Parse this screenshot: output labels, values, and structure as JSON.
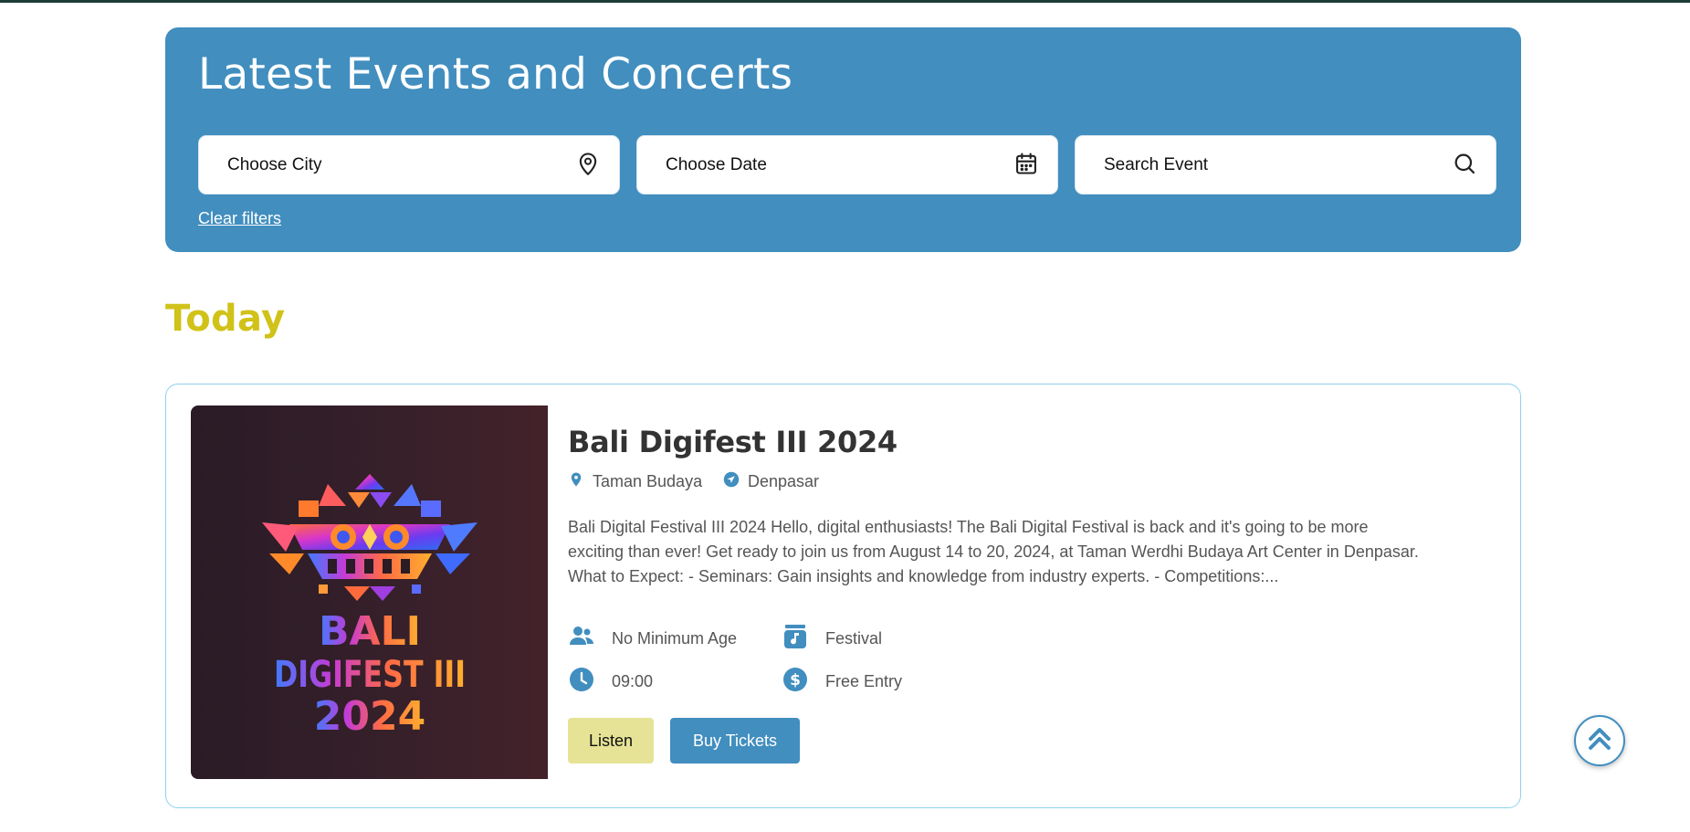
{
  "hero": {
    "title": "Latest Events and Concerts",
    "city_placeholder": "Choose City",
    "date_placeholder": "Choose Date",
    "search_placeholder": "Search Event",
    "clear_filters": "Clear filters"
  },
  "section": {
    "title": "Today"
  },
  "event": {
    "title": "Bali Digifest III 2024",
    "venue": "Taman Budaya",
    "city": "Denpasar",
    "description": "Bali Digital Festival III 2024 Hello, digital enthusiasts! The Bali Digital Festival is back and it's going to be more exciting than ever! Get ready to join us from August 14 to 20, 2024, at Taman Werdhi Budaya Art Center in Denpasar. What to Expect: - Seminars: Gain insights and knowledge from industry experts. - Competitions:...",
    "age": "No Minimum Age",
    "category": "Festival",
    "time": "09:00",
    "price": "Free Entry",
    "listen_label": "Listen",
    "buy_label": "Buy Tickets",
    "poster_lines": [
      "BALI",
      "DIGIFEST III",
      "2024"
    ]
  },
  "colors": {
    "hero_bg": "#418ebf",
    "accent_yellow": "#d1c219",
    "listen_bg": "#e6e396",
    "card_border": "#8ed0ee"
  },
  "icons": [
    "map-pin-icon",
    "calendar-icon",
    "search-icon",
    "location-pin-icon",
    "navigation-icon",
    "person-icon",
    "music-box-icon",
    "clock-icon",
    "dollar-icon",
    "chevrons-up-icon"
  ]
}
